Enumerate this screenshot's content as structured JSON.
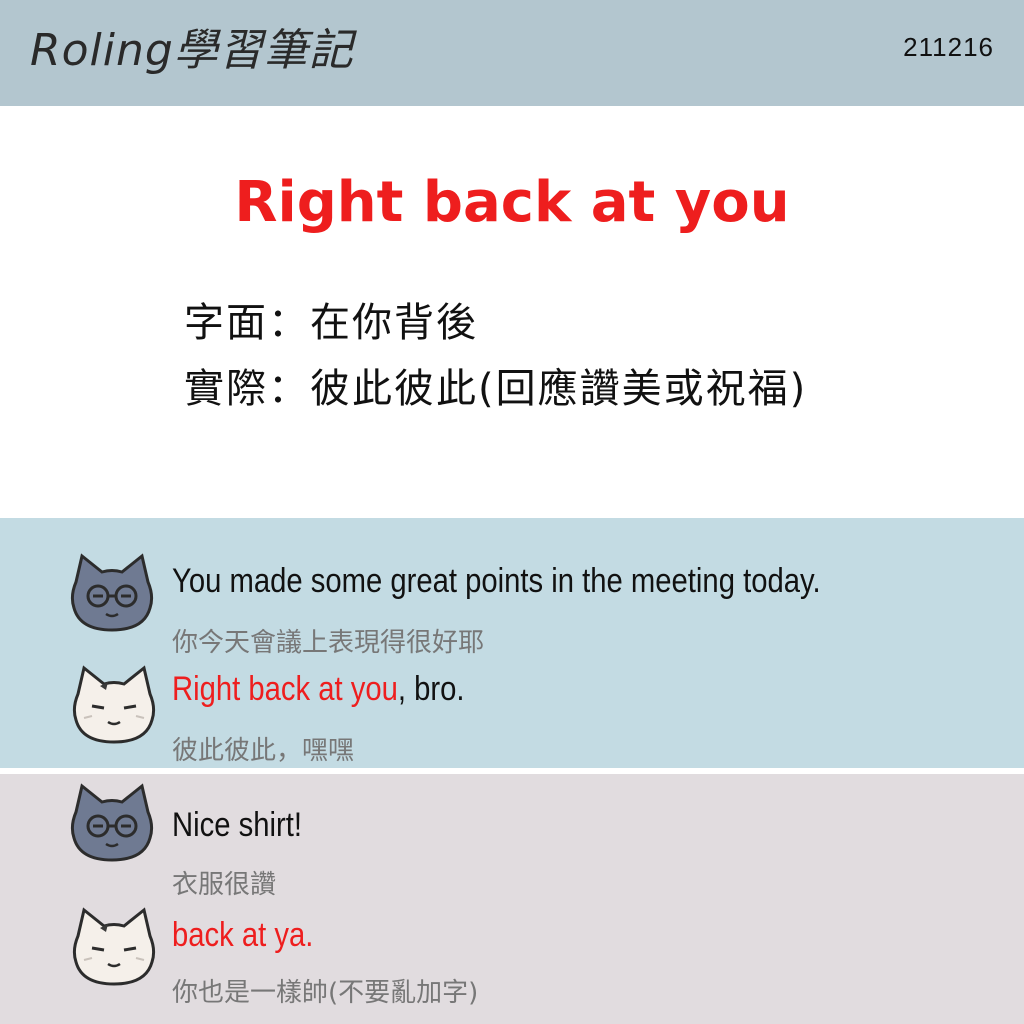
{
  "header": {
    "brand": "Roling學習筆記",
    "date": "211216"
  },
  "main": {
    "title": "Right back at you",
    "literal_line": "字面：在你背後",
    "actual_line": "實際：彼此彼此(回應讚美或祝福)"
  },
  "dialogs": [
    {
      "en": "You made some great points in the meeting today.",
      "zh": "你今天會議上表現得很好耶"
    },
    {
      "en_highlight": "Right back at you",
      "en_rest": ", bro.",
      "zh": "彼此彼此，嘿嘿"
    },
    {
      "en": "Nice shirt!",
      "zh": "衣服很讚"
    },
    {
      "en_highlight": "back at ya.",
      "zh": "你也是一樣帥(不要亂加字)"
    }
  ],
  "icons": [
    "gray-cat-glasses-icon",
    "white-cat-icon"
  ],
  "colors": {
    "accent_red": "#ee1e1e",
    "header_bg": "#b3c6cf",
    "panel_blue": "#c3dbe3",
    "panel_pink": "#e1dcdf"
  }
}
